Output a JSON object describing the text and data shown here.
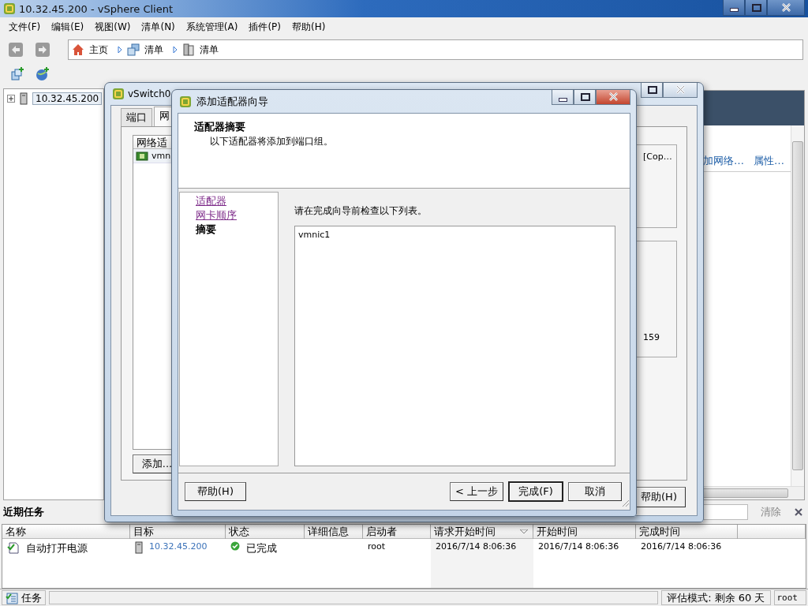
{
  "window": {
    "title": "10.32.45.200 - vSphere Client"
  },
  "menu": [
    {
      "label": "文件(F)"
    },
    {
      "label": "编辑(E)"
    },
    {
      "label": "视图(W)"
    },
    {
      "label": "清单(N)"
    },
    {
      "label": "系统管理(A)"
    },
    {
      "label": "插件(P)"
    },
    {
      "label": "帮助(H)"
    }
  ],
  "breadcrumb": [
    {
      "label": "主页",
      "kind": "home"
    },
    {
      "label": "清单",
      "kind": "inventory"
    },
    {
      "label": "清单",
      "kind": "host"
    }
  ],
  "tree": [
    {
      "label": "10.32.45.200",
      "expanded": false,
      "selected": true
    }
  ],
  "main_panel": {
    "links": [
      "加网络…",
      "属性…"
    ]
  },
  "recent_tasks": {
    "title": "近期任务",
    "clear": "清除",
    "columns": [
      {
        "label": "名称",
        "sorted": false
      },
      {
        "label": "目标",
        "sorted": false
      },
      {
        "label": "状态",
        "sorted": false
      },
      {
        "label": "详细信息",
        "sorted": false
      },
      {
        "label": "启动者",
        "sorted": false
      },
      {
        "label": "请求开始时间",
        "sorted": true
      },
      {
        "label": "开始时间",
        "sorted": false
      },
      {
        "label": "完成时间",
        "sorted": false
      }
    ],
    "rows": [
      {
        "name": "自动打开电源",
        "target": "10.32.45.200",
        "status": "已完成",
        "initiator": "root",
        "requested": "2016/7/14 8:06:36",
        "started": "2016/7/14 8:06:36",
        "completed": "2016/7/14 8:06:36"
      }
    ]
  },
  "status_bar": {
    "tasks_button": "任务",
    "license": "评估模式: 剩余 60 天",
    "user": "root"
  },
  "vswitch_dialog": {
    "title": "vSwitch0",
    "tabs": [
      {
        "label": "端口",
        "selected": false
      },
      {
        "label": "网",
        "selected": true
      }
    ],
    "adapter_column": "网络适",
    "adapters": [
      "vmn"
    ],
    "add_button": "添加...",
    "details": [
      "[Cop…",
      "159"
    ],
    "help_button": "帮助(H)"
  },
  "wizard": {
    "title": "添加适配器向导",
    "heading": "适配器摘要",
    "subheading": "以下适配器将添加到端口组。",
    "steps": [
      {
        "label": "适配器",
        "selected": false
      },
      {
        "label": "网卡顺序",
        "selected": false
      },
      {
        "label": "摘要",
        "selected": true
      }
    ],
    "instruction": "请在完成向导前检查以下列表。",
    "items": [
      "vmnic1"
    ],
    "help_button": "帮助(H)",
    "buttons": [
      {
        "label": "< 上一步",
        "default": false
      },
      {
        "label": "完成(F)",
        "default": true
      },
      {
        "label": "取消",
        "default": false
      }
    ]
  }
}
